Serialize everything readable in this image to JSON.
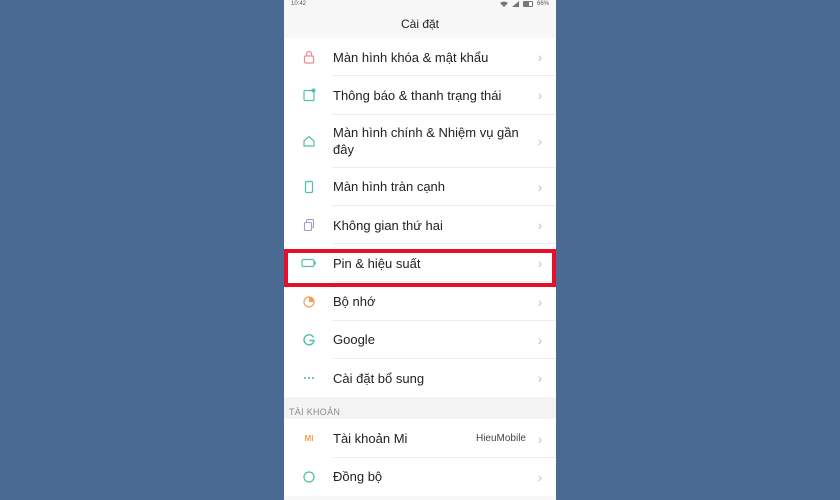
{
  "status_bar": {
    "time": "10:42",
    "battery": "66%"
  },
  "header": {
    "title": "Cài đặt"
  },
  "settings_items": [
    {
      "label": "Màn hình khóa & mật khẩu",
      "icon": "lock-icon",
      "color": "#f08c8c"
    },
    {
      "label": "Thông báo & thanh trạng thái",
      "icon": "notification-icon",
      "color": "#4ec0a8"
    },
    {
      "label": "Màn hình chính & Nhiệm vụ gần đây",
      "icon": "home-icon",
      "color": "#4ec0a8"
    },
    {
      "label": "Màn hình tràn cạnh",
      "icon": "fullscreen-phone-icon",
      "color": "#4ec0a8"
    },
    {
      "label": "Không gian thứ hai",
      "icon": "second-space-icon",
      "color": "#9aa0c8"
    },
    {
      "label": "Pin & hiệu suất",
      "icon": "battery-icon",
      "color": "#4ec0a8"
    },
    {
      "label": "Bộ nhớ",
      "icon": "storage-icon",
      "color": "#f4a050"
    },
    {
      "label": "Google",
      "icon": "google-icon",
      "color": "#4ec0a8"
    },
    {
      "label": "Cài đặt bổ sung",
      "icon": "more-dots-icon",
      "color": "#4ea8c8"
    }
  ],
  "accounts_section": {
    "header": "TÀI KHOẢN",
    "items": [
      {
        "label": "Tài khoản Mi",
        "value": "HieuMobile",
        "icon": "mi-account-icon",
        "icon_text": "MI",
        "color": "#f4a050"
      },
      {
        "label": "Đồng bộ",
        "icon": "sync-icon",
        "color": "#4ec0a8"
      }
    ]
  },
  "highlight": {
    "color": "#e3102b",
    "target": "Pin & hiệu suất"
  }
}
